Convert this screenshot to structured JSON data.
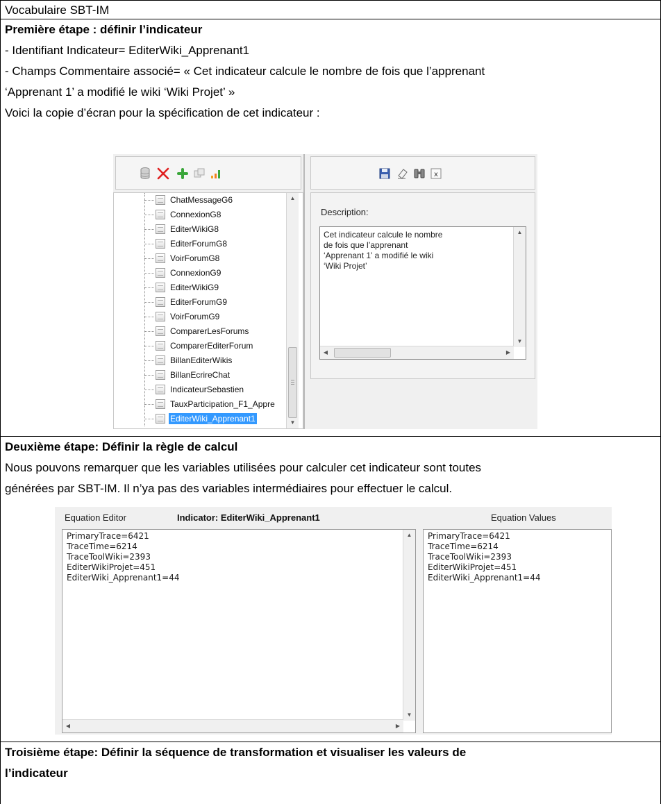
{
  "header": {
    "title": "Vocabulaire SBT-IM"
  },
  "step1": {
    "heading": "Première étape : définir l’indicateur",
    "lines": [
      "- Identifiant Indicateur= EditerWiki_Apprenant1",
      "- Champs Commentaire associé= « Cet indicateur calcule le nombre de fois que l’apprenant",
      "‘Apprenant 1’ a modifié le wiki ‘Wiki Projet’ »",
      "Voici la copie d’écran pour la spécification de cet indicateur :"
    ],
    "screenshot": {
      "toolbar_left_icons": [
        "database-icon",
        "delete-icon",
        "add-icon",
        "copy-icon",
        "bar-chart-icon"
      ],
      "toolbar_right_icons": [
        "save-icon",
        "eraser-icon",
        "binoculars-icon",
        "formula-icon"
      ],
      "tree_items": [
        "ChatMessageG6",
        "ConnexionG8",
        "EditerWikiG8",
        "EditerForumG8",
        "VoirForumG8",
        "ConnexionG9",
        "EditerWikiG9",
        "EditerForumG9",
        "VoirForumG9",
        "ComparerLesForums",
        "ComparerEditerForum",
        "BillanEditerWikis",
        "BillanEcrireChat",
        "IndicateurSebastien",
        "TauxParticipation_F1_Appre",
        "EditerWiki_Apprenant1"
      ],
      "selected_item": "EditerWiki_Apprenant1",
      "description_label": "Description:",
      "description_text": "Cet indicateur calcule le nombre\nde fois que l’apprenant\n‘Apprenant 1’ a modifié le wiki\n‘Wiki Projet’"
    }
  },
  "step2": {
    "heading": "Deuxième étape: Définir la règle de calcul",
    "lines": [
      "Nous pouvons remarquer que les variables utilisées pour calculer cet indicateur sont toutes",
      "générées par SBT-IM. Il n’ya pas des variables intermédiaires pour effectuer le calcul."
    ],
    "screenshot": {
      "editor_label": "Equation Editor",
      "indicator_label": "Indicator: EditerWiki_Apprenant1",
      "values_label": "Equation Values",
      "editor_text": "PrimaryTrace=6421\nTraceTime=6214\nTraceToolWiki=2393\nEditerWikiProjet=451\nEditerWiki_Apprenant1=44",
      "values_text": "PrimaryTrace=6421\nTraceTime=6214\nTraceToolWiki=2393\nEditerWikiProjet=451\nEditerWiki_Apprenant1=44"
    }
  },
  "step3": {
    "heading_lines": [
      "Troisième étape: Définir la séquence de transformation et visualiser les valeurs de",
      "l’indicateur"
    ]
  }
}
